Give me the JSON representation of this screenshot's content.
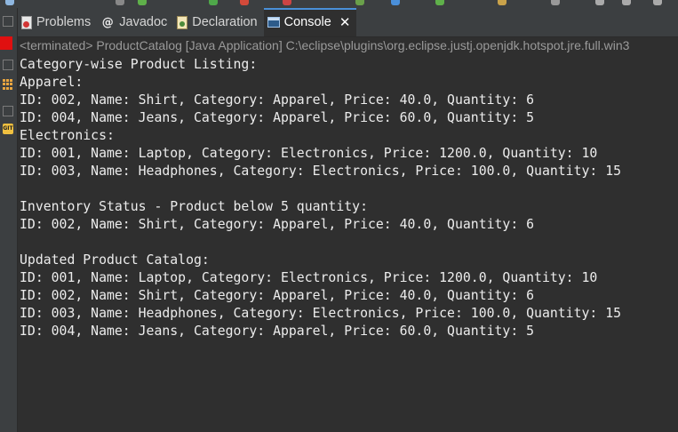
{
  "tabs": [
    {
      "label": "Problems",
      "icon": "problems-icon"
    },
    {
      "label": "Javadoc",
      "icon": "javadoc-icon"
    },
    {
      "label": "Declaration",
      "icon": "declaration-icon"
    },
    {
      "label": "Console",
      "icon": "console-icon",
      "active": true,
      "closable": true
    }
  ],
  "tab_close_glyph": "✕",
  "console": {
    "header": "<terminated> ProductCatalog [Java Application] C:\\eclipse\\plugins\\org.eclipse.justj.openjdk.hotspot.jre.full.win3",
    "lines": [
      "Category-wise Product Listing:",
      "Apparel:",
      "ID: 002, Name: Shirt, Category: Apparel, Price: 40.0, Quantity: 6",
      "ID: 004, Name: Jeans, Category: Apparel, Price: 60.0, Quantity: 5",
      "Electronics:",
      "ID: 001, Name: Laptop, Category: Electronics, Price: 1200.0, Quantity: 10",
      "ID: 003, Name: Headphones, Category: Electronics, Price: 100.0, Quantity: 15",
      "",
      "Inventory Status - Product below 5 quantity:",
      "ID: 002, Name: Shirt, Category: Apparel, Price: 40.0, Quantity: 6",
      "",
      "Updated Product Catalog:",
      "ID: 001, Name: Laptop, Category: Electronics, Price: 1200.0, Quantity: 10",
      "ID: 002, Name: Shirt, Category: Apparel, Price: 40.0, Quantity: 6",
      "ID: 003, Name: Headphones, Category: Electronics, Price: 100.0, Quantity: 15",
      "ID: 004, Name: Jeans, Category: Apparel, Price: 60.0, Quantity: 5"
    ]
  },
  "colors": {
    "background": "#2f2f2f",
    "console_text": "#ececec",
    "header_text": "#9a9a9a",
    "terminate_button": "#e01010"
  }
}
